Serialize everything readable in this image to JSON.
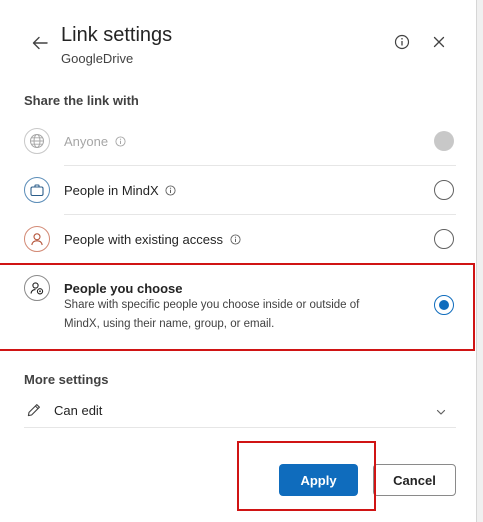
{
  "header": {
    "title": "Link settings",
    "subtitle": "GoogleDrive"
  },
  "share": {
    "heading": "Share the link with",
    "options": [
      {
        "label": "Anyone",
        "state": "disabled",
        "icon": "globe-icon"
      },
      {
        "label": "People in MindX",
        "state": "unselected",
        "icon": "briefcase-icon"
      },
      {
        "label": "People with existing access",
        "state": "unselected",
        "icon": "person-icon"
      },
      {
        "label": "People you choose",
        "description": "Share with specific people you choose inside or outside of MindX, using their name, group, or email.",
        "state": "selected",
        "icon": "people-settings-icon"
      }
    ]
  },
  "more": {
    "heading": "More settings",
    "permission": "Can edit"
  },
  "buttons": {
    "apply": "Apply",
    "cancel": "Cancel"
  },
  "colors": {
    "accent": "#0f6cbd",
    "highlight": "#d01414"
  }
}
